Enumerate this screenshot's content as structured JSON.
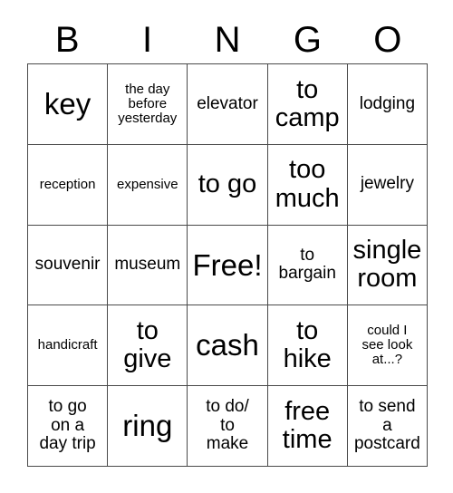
{
  "card": {
    "title_letters": [
      "B",
      "I",
      "N",
      "G",
      "O"
    ],
    "columns": 5,
    "rows": 5,
    "free_space_label": "Free!",
    "free_space_position": {
      "row": 3,
      "column": 3
    },
    "grid_line_color": "#4a4a4a",
    "text_color": "#000000",
    "background_color": "#ffffff",
    "cells": [
      [
        {
          "text": "key",
          "size": "xxl"
        },
        {
          "text": "the day\nbefore\nyesterday",
          "size": "s"
        },
        {
          "text": "elevator",
          "size": "m"
        },
        {
          "text": "to\ncamp",
          "size": "xl"
        },
        {
          "text": "lodging",
          "size": "m"
        }
      ],
      [
        {
          "text": "reception",
          "size": "s"
        },
        {
          "text": "expensive",
          "size": "s"
        },
        {
          "text": "to go",
          "size": "xl"
        },
        {
          "text": "too\nmuch",
          "size": "xl"
        },
        {
          "text": "jewelry",
          "size": "m"
        }
      ],
      [
        {
          "text": "souvenir",
          "size": "m"
        },
        {
          "text": "museum",
          "size": "m"
        },
        {
          "text": "Free!",
          "size": "xxl"
        },
        {
          "text": "to\nbargain",
          "size": "m"
        },
        {
          "text": "single\nroom",
          "size": "xl"
        }
      ],
      [
        {
          "text": "handicraft",
          "size": "s"
        },
        {
          "text": "to\ngive",
          "size": "xl"
        },
        {
          "text": "cash",
          "size": "xxl"
        },
        {
          "text": "to\nhike",
          "size": "xl"
        },
        {
          "text": "could I\nsee look\nat...?",
          "size": "s"
        }
      ],
      [
        {
          "text": "to go\non a\nday trip",
          "size": "m"
        },
        {
          "text": "ring",
          "size": "xxl"
        },
        {
          "text": "to do/\nto\nmake",
          "size": "m"
        },
        {
          "text": "free\ntime",
          "size": "xl"
        },
        {
          "text": "to send\na\npostcard",
          "size": "m"
        }
      ]
    ]
  }
}
